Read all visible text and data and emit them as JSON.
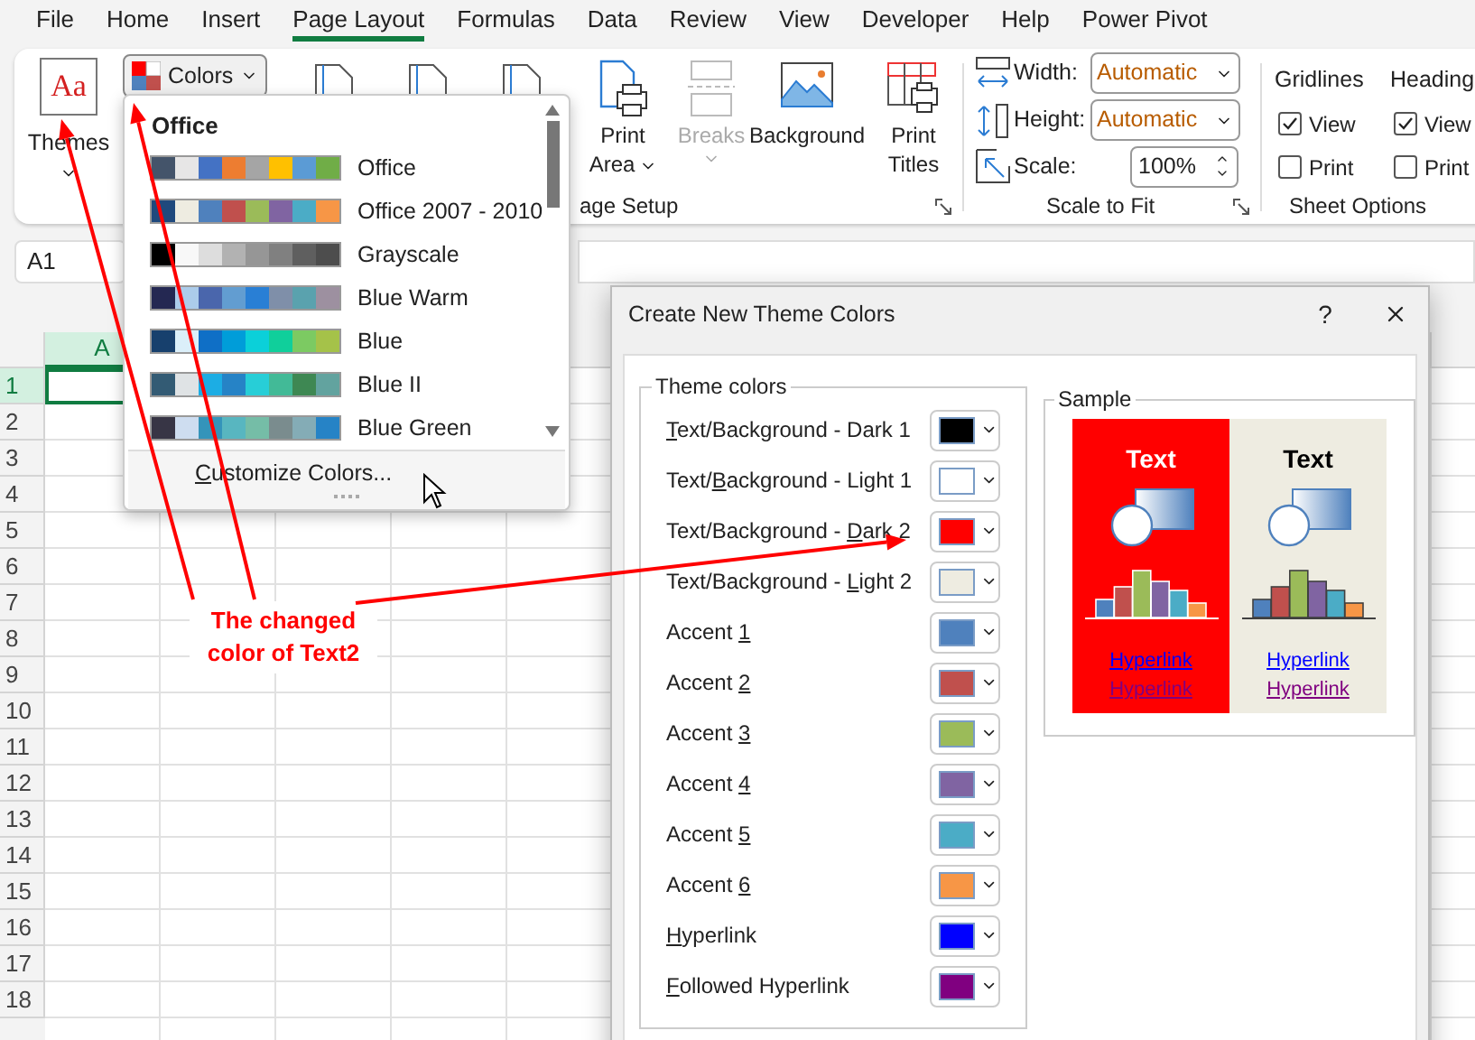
{
  "menu_tabs": [
    {
      "label": "File",
      "selected": false
    },
    {
      "label": "Home",
      "selected": false
    },
    {
      "label": "Insert",
      "selected": false
    },
    {
      "label": "Page Layout",
      "selected": true
    },
    {
      "label": "Formulas",
      "selected": false
    },
    {
      "label": "Data",
      "selected": false
    },
    {
      "label": "Review",
      "selected": false
    },
    {
      "label": "View",
      "selected": false
    },
    {
      "label": "Developer",
      "selected": false
    },
    {
      "label": "Help",
      "selected": false
    },
    {
      "label": "Power Pivot",
      "selected": false
    }
  ],
  "ribbon": {
    "themes": {
      "icon_text": "Aa",
      "label": "Themes"
    },
    "colors_button": {
      "label": "Colors"
    },
    "page_setup": {
      "buttons": [
        {
          "label": "Print Area",
          "kind": "print-area",
          "dropdown": true,
          "disabled": false
        },
        {
          "label": "Breaks",
          "kind": "breaks",
          "dropdown": true,
          "disabled": true
        },
        {
          "label": "Background",
          "kind": "background",
          "dropdown": false,
          "disabled": false
        },
        {
          "label": "Print Titles",
          "kind": "print-titles",
          "dropdown": false,
          "disabled": false
        }
      ],
      "group_label": "age Setup"
    },
    "scale_to_fit": {
      "fields": [
        {
          "kind": "width",
          "label": "Width:",
          "value": "Automatic"
        },
        {
          "kind": "height",
          "label": "Height:",
          "value": "Automatic"
        },
        {
          "kind": "scale",
          "label": "Scale:",
          "value": "100%"
        }
      ],
      "group_label": "Scale to Fit"
    },
    "sheet_options": {
      "columns": [
        {
          "title": "Gridlines",
          "options": [
            {
              "label": "View",
              "checked": true
            },
            {
              "label": "Print",
              "checked": false
            }
          ]
        },
        {
          "title": "Heading",
          "options": [
            {
              "label": "View",
              "checked": true
            },
            {
              "label": "Print",
              "checked": false
            }
          ]
        }
      ],
      "group_label": "Sheet Options"
    }
  },
  "formula_bar": {
    "name_box": "A1"
  },
  "sheet": {
    "columns": [
      "A"
    ],
    "rows": [
      "1",
      "2",
      "3",
      "4",
      "5",
      "6",
      "7",
      "8",
      "9",
      "10",
      "11",
      "12",
      "13",
      "14",
      "15",
      "16",
      "17",
      "18"
    ]
  },
  "colors_menu": {
    "section": "Office",
    "items": [
      {
        "label": "Office",
        "colors": [
          {
            "color": "#44546a"
          },
          {
            "color": "#e7e6e6"
          },
          {
            "color": "#4472c4"
          },
          {
            "color": "#ed7d31"
          },
          {
            "color": "#a5a5a5"
          },
          {
            "color": "#ffc000"
          },
          {
            "color": "#5b9bd5"
          },
          {
            "color": "#70ad47"
          }
        ]
      },
      {
        "label": "Office 2007 - 2010",
        "colors": [
          {
            "color": "#1f497d"
          },
          {
            "color": "#eeece1"
          },
          {
            "color": "#4f81bd"
          },
          {
            "color": "#c0504d"
          },
          {
            "color": "#9bbb59"
          },
          {
            "color": "#8064a2"
          },
          {
            "color": "#4bacc6"
          },
          {
            "color": "#f79646"
          }
        ]
      },
      {
        "label": "Grayscale",
        "colors": [
          {
            "color": "#000000"
          },
          {
            "color": "#f8f8f8"
          },
          {
            "color": "#dddddd"
          },
          {
            "color": "#b2b2b2"
          },
          {
            "color": "#969696"
          },
          {
            "color": "#808080"
          },
          {
            "color": "#5f5f5f"
          },
          {
            "color": "#4d4d4d"
          }
        ]
      },
      {
        "label": "Blue Warm",
        "colors": [
          {
            "color": "#242852"
          },
          {
            "color": "#acccea"
          },
          {
            "color": "#4a66ac"
          },
          {
            "color": "#629dd1"
          },
          {
            "color": "#297fd5"
          },
          {
            "color": "#7f8fa9"
          },
          {
            "color": "#5aa2ae"
          },
          {
            "color": "#9d90a0"
          }
        ]
      },
      {
        "label": "Blue",
        "colors": [
          {
            "color": "#17406d"
          },
          {
            "color": "#dbeff9"
          },
          {
            "color": "#0f6fc6"
          },
          {
            "color": "#009dd9"
          },
          {
            "color": "#0bd0d9"
          },
          {
            "color": "#10cf9b"
          },
          {
            "color": "#7cca62"
          },
          {
            "color": "#a5c249"
          }
        ]
      },
      {
        "label": "Blue II",
        "colors": [
          {
            "color": "#335b74"
          },
          {
            "color": "#dfe3e5"
          },
          {
            "color": "#1cade4"
          },
          {
            "color": "#2683c6"
          },
          {
            "color": "#27ced7"
          },
          {
            "color": "#42ba97"
          },
          {
            "color": "#3e8853"
          },
          {
            "color": "#62a39f"
          }
        ]
      },
      {
        "label": "Blue Green",
        "colors": [
          {
            "color": "#373545"
          },
          {
            "color": "#ceddf0"
          },
          {
            "color": "#3494ba"
          },
          {
            "color": "#58b6c0"
          },
          {
            "color": "#75bda7"
          },
          {
            "color": "#7a8c8e"
          },
          {
            "color": "#84acb6"
          },
          {
            "color": "#2683c6"
          }
        ]
      }
    ],
    "customize": [
      {
        "text": "C",
        "underlined": true
      },
      {
        "text": "ustomize Colors...",
        "underlined": false
      }
    ]
  },
  "dialog": {
    "title": "Create New Theme Colors",
    "help": "?",
    "theme_colors": {
      "legend": "Theme colors",
      "items": [
        {
          "label": [
            {
              "text": "T",
              "underlined": true
            },
            {
              "text": "ext/Background - Dark 1",
              "underlined": false
            }
          ],
          "color": "#000000"
        },
        {
          "label": [
            {
              "text": "Text/",
              "underlined": false
            },
            {
              "text": "B",
              "underlined": true
            },
            {
              "text": "ackground - Light 1",
              "underlined": false
            }
          ],
          "color": "#ffffff"
        },
        {
          "label": [
            {
              "text": "Text/Background - ",
              "underlined": false
            },
            {
              "text": "D",
              "underlined": true
            },
            {
              "text": "ark 2",
              "underlined": false
            }
          ],
          "color": "#ff0000"
        },
        {
          "label": [
            {
              "text": "Text/Background - ",
              "underlined": false
            },
            {
              "text": "L",
              "underlined": true
            },
            {
              "text": "ight 2",
              "underlined": false
            }
          ],
          "color": "#eeece1"
        },
        {
          "label": [
            {
              "text": "Accent ",
              "underlined": false
            },
            {
              "text": "1",
              "underlined": true
            }
          ],
          "color": "#4f81bd"
        },
        {
          "label": [
            {
              "text": "Accent ",
              "underlined": false
            },
            {
              "text": "2",
              "underlined": true
            }
          ],
          "color": "#c0504d"
        },
        {
          "label": [
            {
              "text": "Accent ",
              "underlined": false
            },
            {
              "text": "3",
              "underlined": true
            }
          ],
          "color": "#9bbb59"
        },
        {
          "label": [
            {
              "text": "Accent ",
              "underlined": false
            },
            {
              "text": "4",
              "underlined": true
            }
          ],
          "color": "#8064a2"
        },
        {
          "label": [
            {
              "text": "Accent ",
              "underlined": false
            },
            {
              "text": "5",
              "underlined": true
            }
          ],
          "color": "#4bacc6"
        },
        {
          "label": [
            {
              "text": "Accent ",
              "underlined": false
            },
            {
              "text": "6",
              "underlined": true
            }
          ],
          "color": "#f79646"
        },
        {
          "label": [
            {
              "text": "H",
              "underlined": true
            },
            {
              "text": "yperlink",
              "underlined": false
            }
          ],
          "color": "#0000ff"
        },
        {
          "label": [
            {
              "text": "F",
              "underlined": true
            },
            {
              "text": "ollowed Hyperlink",
              "underlined": false
            }
          ],
          "color": "#800080"
        }
      ]
    },
    "sample": {
      "legend": "Sample",
      "panels": [
        {
          "title": "Text",
          "links": [
            "Hyperlink",
            "Hyperlink"
          ]
        },
        {
          "title": "Text",
          "links": [
            "Hyperlink",
            "Hyperlink"
          ]
        }
      ]
    }
  },
  "annotation": {
    "text": "The changed color of Text2"
  }
}
